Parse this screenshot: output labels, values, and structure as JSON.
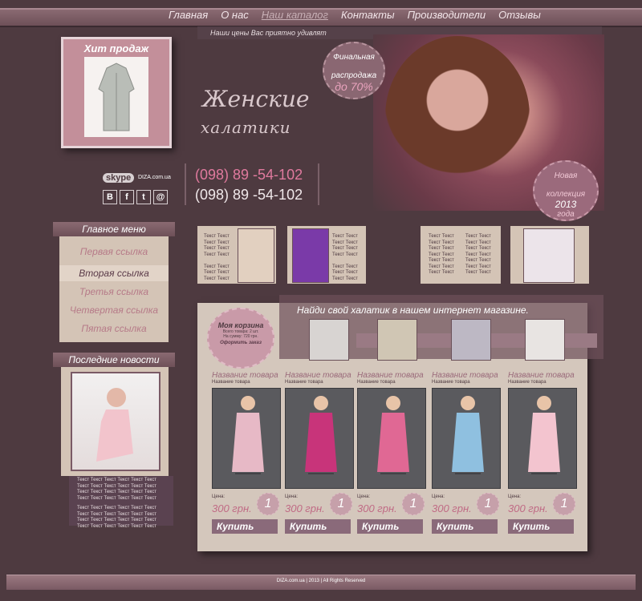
{
  "nav": {
    "items": [
      "Главная",
      "О нас",
      "Наш каталог",
      "Контакты",
      "Производители",
      "Отзывы"
    ],
    "active_index": 2
  },
  "tagline": "Наши цены Вас приятно удивлят",
  "hit": {
    "title": "Хит продаж"
  },
  "logo": {
    "line1": "Женские",
    "line2": "халатики"
  },
  "sale": {
    "line1": "Финальная",
    "line2": "распродажа",
    "line3": "до 70%"
  },
  "new_collection": {
    "line1": "Новая",
    "line2": "коллекция",
    "year": "2013",
    "line4": "года"
  },
  "contacts": {
    "skype_label": "skype",
    "site": "DIZA.com.ua",
    "phone1": "(098) 89 -54-102",
    "phone2": "(098) 89 -54-102",
    "social_icons": [
      "vk-icon",
      "facebook-icon",
      "twitter-icon",
      "email-icon"
    ]
  },
  "menu": {
    "title": "Главное меню",
    "items": [
      "Первая ссылка",
      "Вторая ссылка",
      "Третья ссылка",
      "Четвертая ссылка",
      "Пятая ссылка"
    ],
    "active_index": 1
  },
  "news": {
    "title": "Последние новости",
    "text_rows": [
      "Текст Текст  Текст Текст  Текст Текст",
      "Текст Текст  Текст Текст  Текст Текст",
      "Текст Текст  Текст Текст  Текст Текст",
      "Текст Текст  Текст Текст  Текст Текст",
      "",
      "Текст Текст  Текст Текст  Текст Текст",
      "Текст Текст  Текст Текст  Текст Текст",
      "Текст Текст  Текст Текст  Текст Текст",
      "Текст Текст  Текст Текст  Текст Текст"
    ]
  },
  "mini_text": "Текст Текст",
  "catalog": {
    "title": "Найди свой халатик в нашем интернет магазине.",
    "cart": {
      "title": "Моя корзина",
      "line1": "Всего товара: 2 шт.",
      "line2": "На сумму: 720 грн.",
      "order": "Оформить заказ"
    },
    "products": [
      {
        "name": "Название товара",
        "sub": "Название товара",
        "price_label": "Цена:",
        "price": "300 грн.",
        "qty": "1",
        "buy": "Купить",
        "color": "#e7b9c6"
      },
      {
        "name": "Название товара",
        "sub": "Название товара",
        "price_label": "Цена:",
        "price": "300 грн.",
        "qty": "1",
        "buy": "Купить",
        "color": "#c8347a"
      },
      {
        "name": "Название товара",
        "sub": "Название товара",
        "price_label": "Цена:",
        "price": "300 грн.",
        "qty": "1",
        "buy": "Купить",
        "color": "#e06894"
      },
      {
        "name": "Название товара",
        "sub": "Название товара",
        "price_label": "Цена:",
        "price": "300 грн.",
        "qty": "1",
        "buy": "Купить",
        "color": "#8fc0e0"
      },
      {
        "name": "Название товара",
        "sub": "Название товара",
        "price_label": "Цена:",
        "price": "300 грн.",
        "qty": "1",
        "buy": "Купить",
        "color": "#f3c4cf"
      }
    ]
  },
  "footer": "DIZA.com.ua  |  2013  |  All Rights Reserved"
}
